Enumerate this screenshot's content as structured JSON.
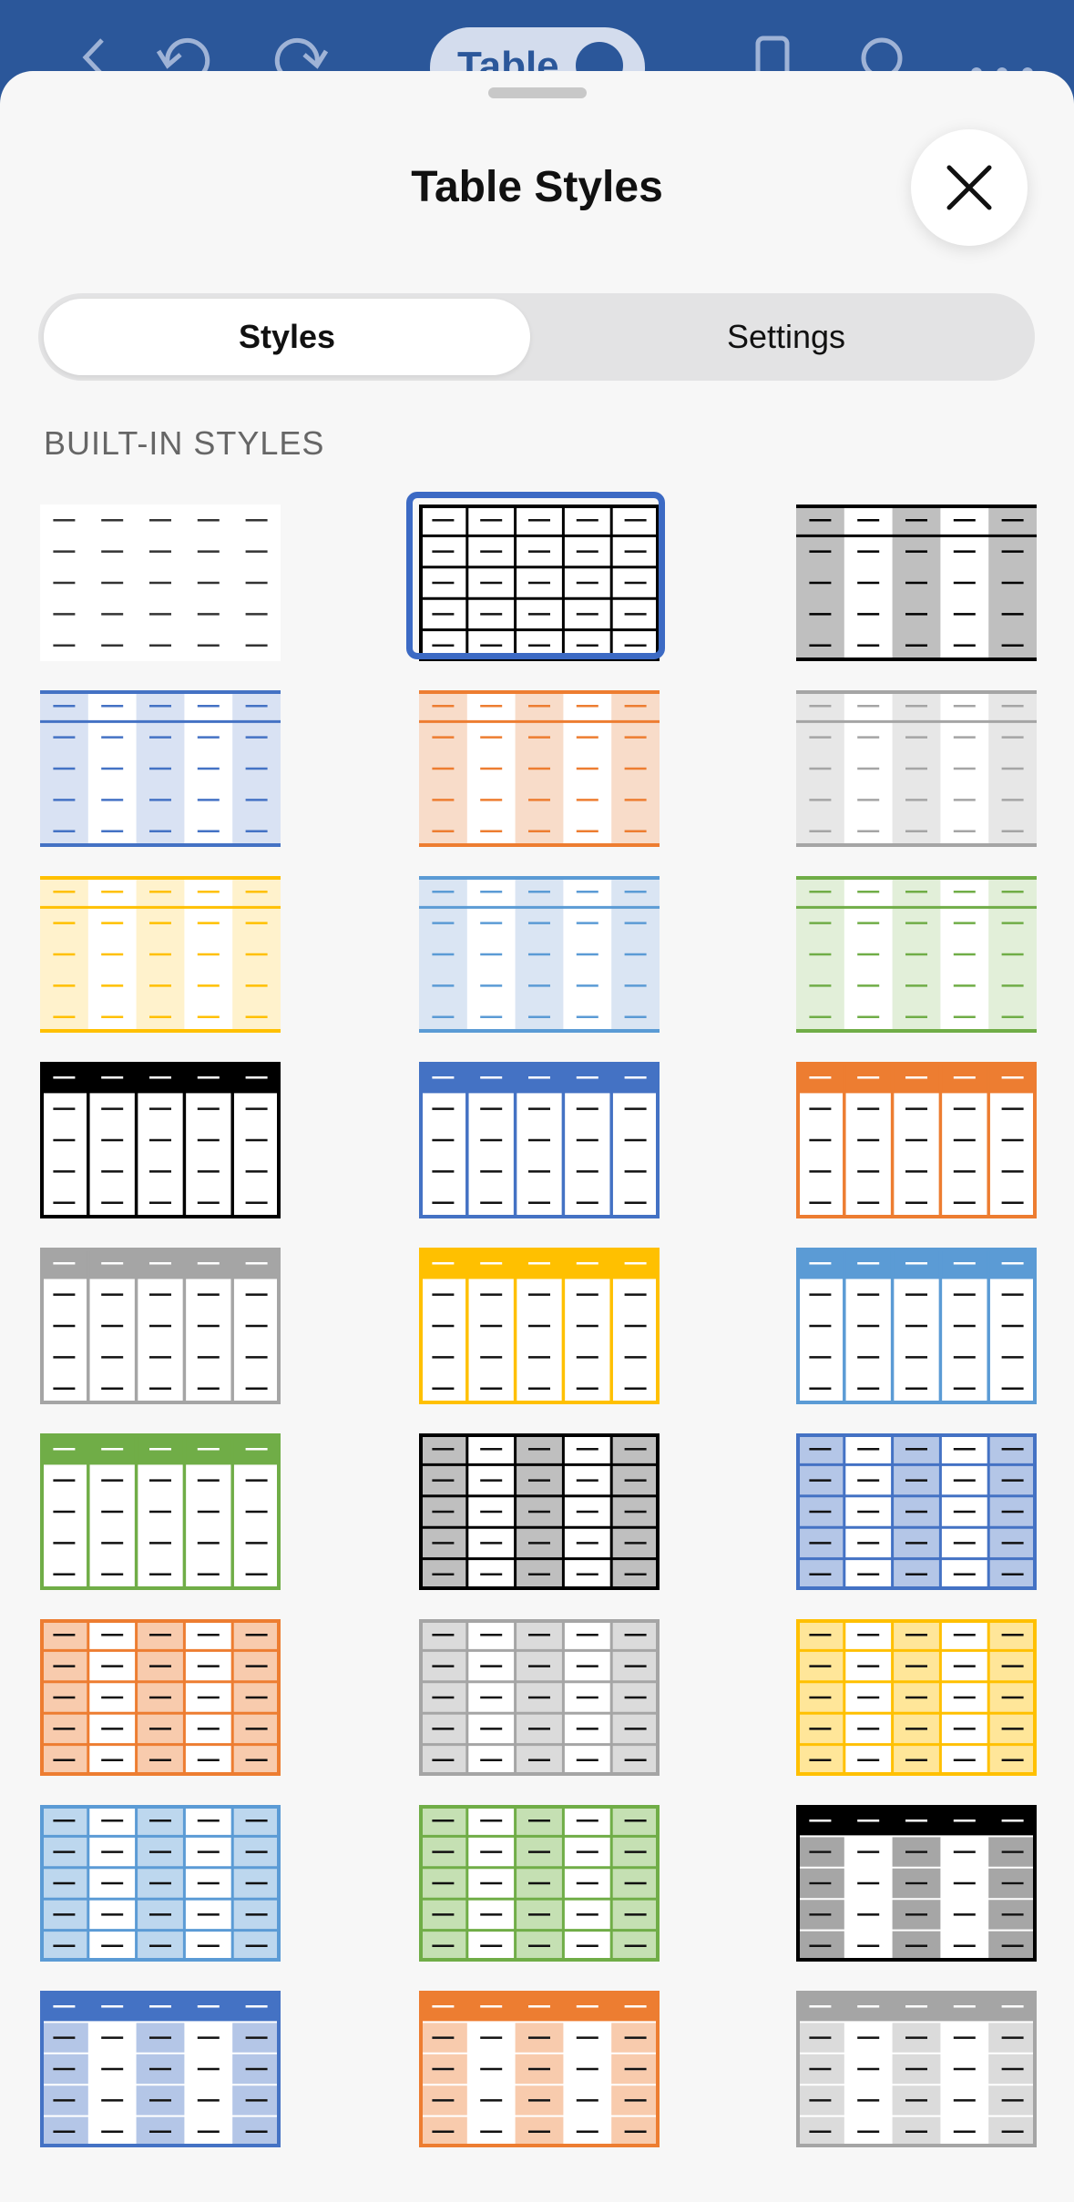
{
  "topbar": {
    "title_text": "Table",
    "icons": [
      "back-arrow-icon",
      "undo-icon",
      "redo-icon",
      "phone-view-icon",
      "search-icon",
      "more-icon"
    ]
  },
  "sheet": {
    "title": "Table Styles",
    "close_icon": "close-icon",
    "tabs": [
      {
        "label": "Styles",
        "selected": true
      },
      {
        "label": "Settings",
        "selected": false
      }
    ],
    "section_label": "BUILT-IN STYLES"
  },
  "styles": [
    {
      "name": "plain",
      "variant": "plain",
      "accent": "#333333",
      "band": "#ffffff",
      "selected": false
    },
    {
      "name": "table-grid",
      "variant": "grid",
      "accent": "#000000",
      "band": "#ffffff",
      "selected": true
    },
    {
      "name": "light-shading-black",
      "variant": "lightCol",
      "accent": "#000000",
      "band": "#bfbfbf",
      "selected": false
    },
    {
      "name": "light-shading-blue",
      "variant": "lightCol",
      "accent": "#4472c4",
      "band": "#d9e2f3",
      "selected": false
    },
    {
      "name": "light-shading-orange",
      "variant": "lightCol",
      "accent": "#ed7d31",
      "band": "#f8dcc9",
      "selected": false
    },
    {
      "name": "light-shading-gray",
      "variant": "lightCol",
      "accent": "#a5a5a5",
      "band": "#e7e7e7",
      "selected": false
    },
    {
      "name": "light-shading-gold",
      "variant": "lightCol",
      "accent": "#ffc000",
      "band": "#fff2cc",
      "selected": false
    },
    {
      "name": "light-shading-lightblue",
      "variant": "lightCol",
      "accent": "#5b9bd5",
      "band": "#dae5f3",
      "selected": false
    },
    {
      "name": "light-shading-green",
      "variant": "lightCol",
      "accent": "#70ad47",
      "band": "#e2efd9",
      "selected": false
    },
    {
      "name": "header-grid-black",
      "variant": "headerCols",
      "accent": "#000000",
      "band": "#ffffff",
      "selected": false
    },
    {
      "name": "header-grid-blue",
      "variant": "headerCols",
      "accent": "#4472c4",
      "band": "#ffffff",
      "selected": false
    },
    {
      "name": "header-grid-orange",
      "variant": "headerCols",
      "accent": "#ed7d31",
      "band": "#ffffff",
      "selected": false
    },
    {
      "name": "header-grid-gray",
      "variant": "headerCols",
      "accent": "#a5a5a5",
      "band": "#ffffff",
      "selected": false
    },
    {
      "name": "header-grid-gold",
      "variant": "headerCols",
      "accent": "#ffc000",
      "band": "#ffffff",
      "selected": false
    },
    {
      "name": "header-grid-lightblue",
      "variant": "headerCols",
      "accent": "#5b9bd5",
      "band": "#ffffff",
      "selected": false
    },
    {
      "name": "header-grid-green",
      "variant": "headerCols",
      "accent": "#70ad47",
      "band": "#ffffff",
      "selected": false
    },
    {
      "name": "banded-grid-black",
      "variant": "bandGrid",
      "accent": "#000000",
      "band": "#bfbfbf",
      "selected": false
    },
    {
      "name": "banded-grid-blue",
      "variant": "bandGrid",
      "accent": "#4472c4",
      "band": "#b4c6e7",
      "selected": false
    },
    {
      "name": "banded-grid-orange",
      "variant": "bandGrid",
      "accent": "#ed7d31",
      "band": "#f8cbad",
      "selected": false
    },
    {
      "name": "banded-grid-gray",
      "variant": "bandGrid",
      "accent": "#a5a5a5",
      "band": "#dbdbdb",
      "selected": false
    },
    {
      "name": "banded-grid-gold",
      "variant": "bandGrid",
      "accent": "#ffc000",
      "band": "#ffe699",
      "selected": false
    },
    {
      "name": "banded-grid-lightblue",
      "variant": "bandGrid",
      "accent": "#5b9bd5",
      "band": "#bdd7ee",
      "selected": false
    },
    {
      "name": "banded-grid-green",
      "variant": "bandGrid",
      "accent": "#70ad47",
      "band": "#c5e0b3",
      "selected": false
    },
    {
      "name": "dark-header-band-black",
      "variant": "headerBand",
      "accent": "#000000",
      "band": "#a6a6a6",
      "selected": false
    },
    {
      "name": "dark-header-band-blue",
      "variant": "headerBand",
      "accent": "#4472c4",
      "band": "#b4c6e7",
      "selected": false
    },
    {
      "name": "dark-header-band-orange",
      "variant": "headerBand",
      "accent": "#ed7d31",
      "band": "#f8cbad",
      "selected": false
    },
    {
      "name": "dark-header-band-gray",
      "variant": "headerBand",
      "accent": "#a5a5a5",
      "band": "#dbdbdb",
      "selected": false
    }
  ]
}
